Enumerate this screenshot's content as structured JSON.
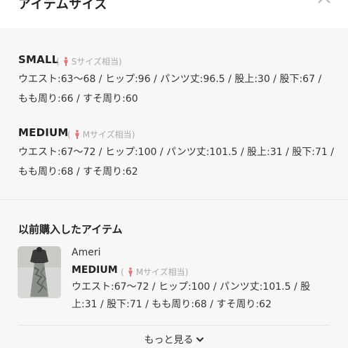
{
  "header": {
    "title": "アイテムサイズ"
  },
  "sizes": [
    {
      "name": "SMALL",
      "hint": "Sサイズ相当",
      "detail": "ウエスト:63〜68 / ヒップ:96 / パンツ丈:96.5 / 股上:30 / 股下:67 / もも周り:66 / すそ周り:60"
    },
    {
      "name": "MEDIUM",
      "hint": "Mサイズ相当",
      "detail": "ウエスト:67〜72 / ヒップ:100 / パンツ丈:101.5 / 股上:31 / 股下:71 / もも周り:68 / すそ周り:62"
    }
  ],
  "previous": {
    "title": "以前購入したアイテム",
    "brand": "Ameri",
    "size": "MEDIUM",
    "hint": "Mサイズ相当",
    "detail": "ウエスト:67〜72 / ヒップ:100 / パンツ丈:101.5 / 股上:31 / 股下:71 / もも周り:68 / すそ周り:62",
    "thumb_icon": "product-thumbnail"
  },
  "more_label": "もっと見る",
  "colors": {
    "accent_person": "#e07a7a",
    "panel_bg": "#f7f7f7",
    "hint": "#aaaaaa"
  }
}
